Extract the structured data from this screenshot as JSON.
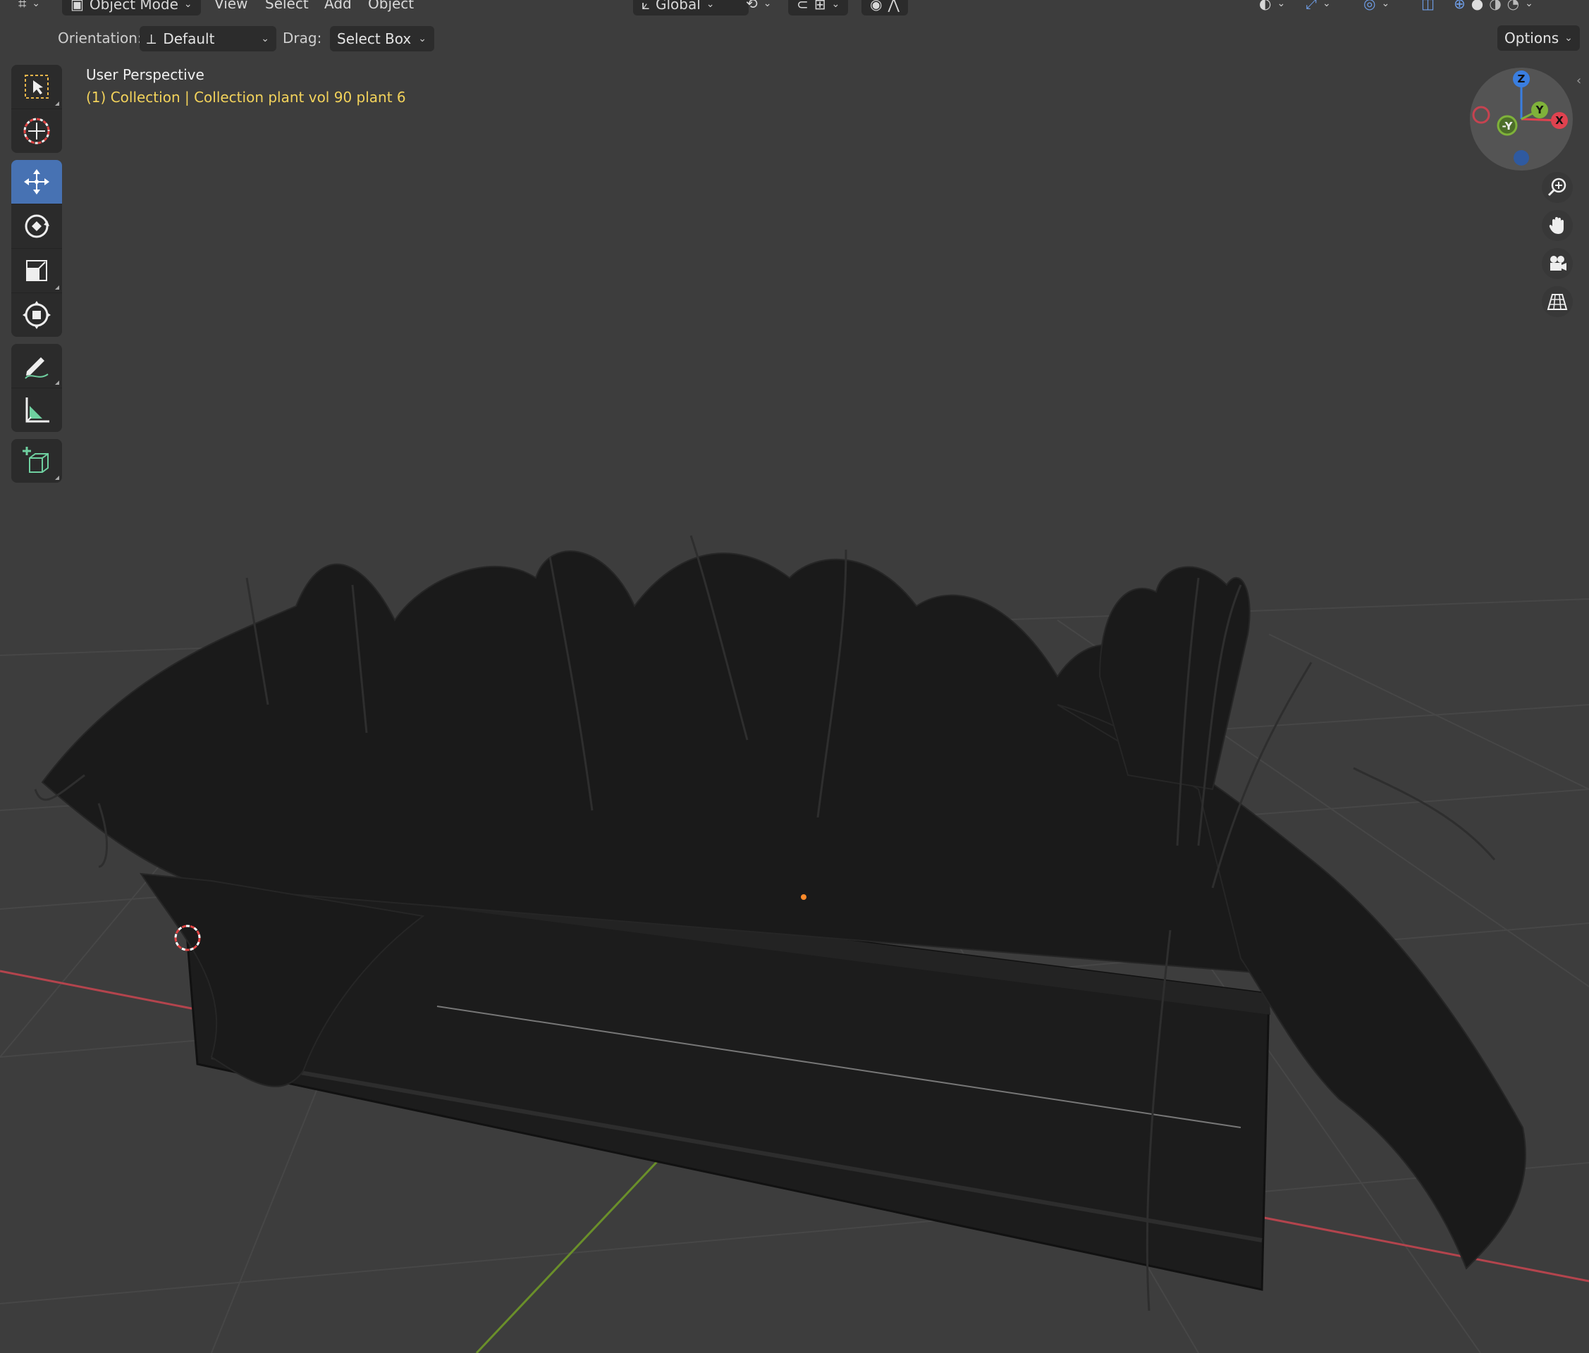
{
  "header": {
    "mode_label": "Object Mode",
    "menus": [
      "View",
      "Select",
      "Add",
      "Object"
    ],
    "transform_orientation": "Global"
  },
  "tool_header": {
    "orientation_label": "Orientation:",
    "orientation_value": "Default",
    "drag_label": "Drag:",
    "drag_value": "Select Box",
    "options_label": "Options"
  },
  "viewport": {
    "view_name": "User Perspective",
    "collection_info": "(1) Collection | Collection plant vol 90 plant 6"
  },
  "gizmo": {
    "axes": {
      "z": "Z",
      "y": "Y",
      "x": "X",
      "neg_y": "-Y"
    }
  },
  "colors": {
    "background": "#3d3d3d",
    "active_tool": "#4772b3",
    "info_text": "#f3d35b",
    "x_axis": "#e0424f",
    "y_axis": "#7fb23a",
    "z_axis": "#3a7ee0",
    "x_line": "#b3444d",
    "y_line": "#6a8f2a"
  },
  "toolbar": [
    {
      "icon": "select-box-icon"
    },
    {
      "icon": "cursor-icon"
    },
    {
      "icon": "move-icon",
      "active": true
    },
    {
      "icon": "rotate-icon"
    },
    {
      "icon": "scale-icon"
    },
    {
      "icon": "transform-icon"
    },
    {
      "icon": "annotate-icon"
    },
    {
      "icon": "measure-icon"
    },
    {
      "icon": "add-cube-icon"
    }
  ]
}
